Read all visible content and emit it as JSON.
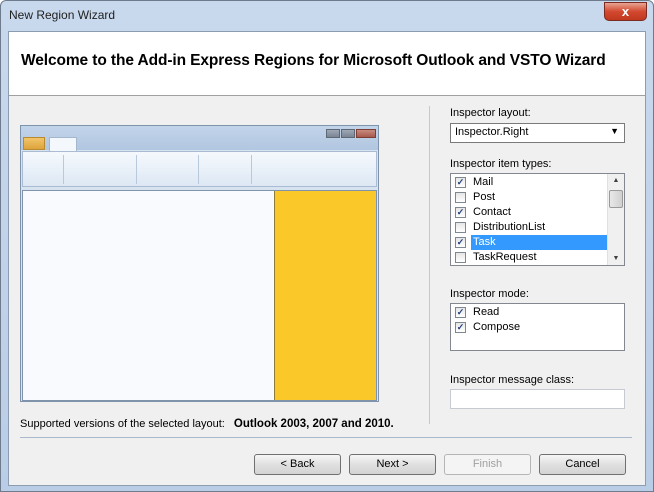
{
  "window": {
    "title": "New Region Wizard",
    "close_glyph": "x"
  },
  "header": {
    "title": "Welcome to the Add-in Express Regions for Microsoft Outlook and VSTO Wizard"
  },
  "preview": {
    "region_color": "#fbc82a"
  },
  "supported": {
    "label": "Supported versions of the selected layout:",
    "versions": "Outlook 2003, 2007 and 2010."
  },
  "inspector_layout": {
    "label": "Inspector layout:",
    "value": "Inspector.Right"
  },
  "item_types": {
    "label": "Inspector item types:",
    "items": [
      {
        "label": "Mail",
        "checked": true
      },
      {
        "label": "Post",
        "checked": false
      },
      {
        "label": "Contact",
        "checked": true
      },
      {
        "label": "DistributionList",
        "checked": false
      },
      {
        "label": "Task",
        "checked": true,
        "selected": true
      },
      {
        "label": "TaskRequest",
        "checked": false
      }
    ]
  },
  "inspector_mode": {
    "label": "Inspector mode:",
    "items": [
      {
        "label": "Read",
        "checked": true
      },
      {
        "label": "Compose",
        "checked": true
      }
    ]
  },
  "message_class": {
    "label": "Inspector message class:",
    "value": ""
  },
  "buttons": {
    "back": "< Back",
    "next": "Next >",
    "finish": "Finish",
    "cancel": "Cancel"
  }
}
